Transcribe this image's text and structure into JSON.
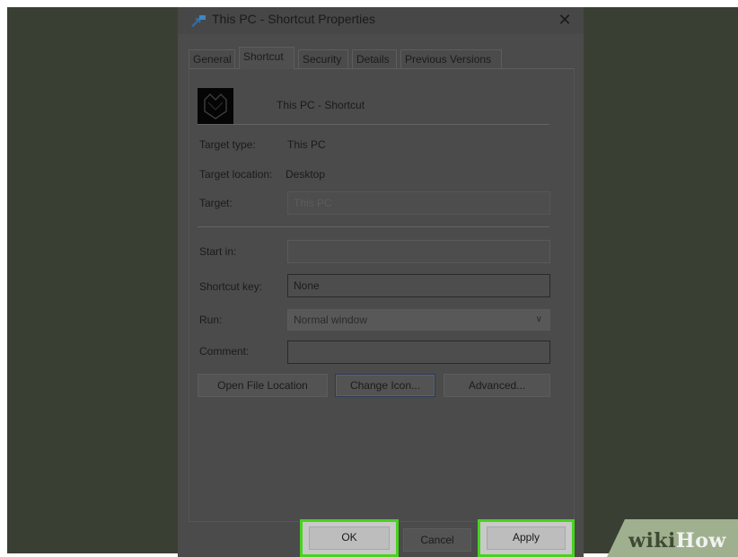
{
  "window": {
    "title": "This PC - Shortcut Properties",
    "close_glyph": "✕"
  },
  "tabs": [
    {
      "label": "General",
      "active": false
    },
    {
      "label": "Shortcut",
      "active": true
    },
    {
      "label": "Security",
      "active": false
    },
    {
      "label": "Details",
      "active": false
    },
    {
      "label": "Previous Versions",
      "active": false
    }
  ],
  "shortcut": {
    "name": "This PC - Shortcut",
    "icon": "this-pc-shortcut-icon"
  },
  "fields": {
    "target_type_label": "Target type:",
    "target_type_value": "This PC",
    "target_location_label": "Target location:",
    "target_location_value": "Desktop",
    "target_label": "Target:",
    "target_value": "This PC",
    "start_in_label": "Start in:",
    "start_in_value": "",
    "shortcut_key_label": "Shortcut key:",
    "shortcut_key_value": "None",
    "run_label": "Run:",
    "run_value": "Normal window",
    "comment_label": "Comment:",
    "comment_value": ""
  },
  "actions": {
    "open_file_location": "Open File Location",
    "change_icon": "Change Icon...",
    "advanced": "Advanced..."
  },
  "footer": {
    "ok": "OK",
    "cancel": "Cancel",
    "apply": "Apply"
  },
  "watermark": {
    "part1": "wiki",
    "part2": "How"
  },
  "colors": {
    "highlight": "#47d31f",
    "background": "#3a3f33",
    "dialog": "#4b4b4b"
  }
}
